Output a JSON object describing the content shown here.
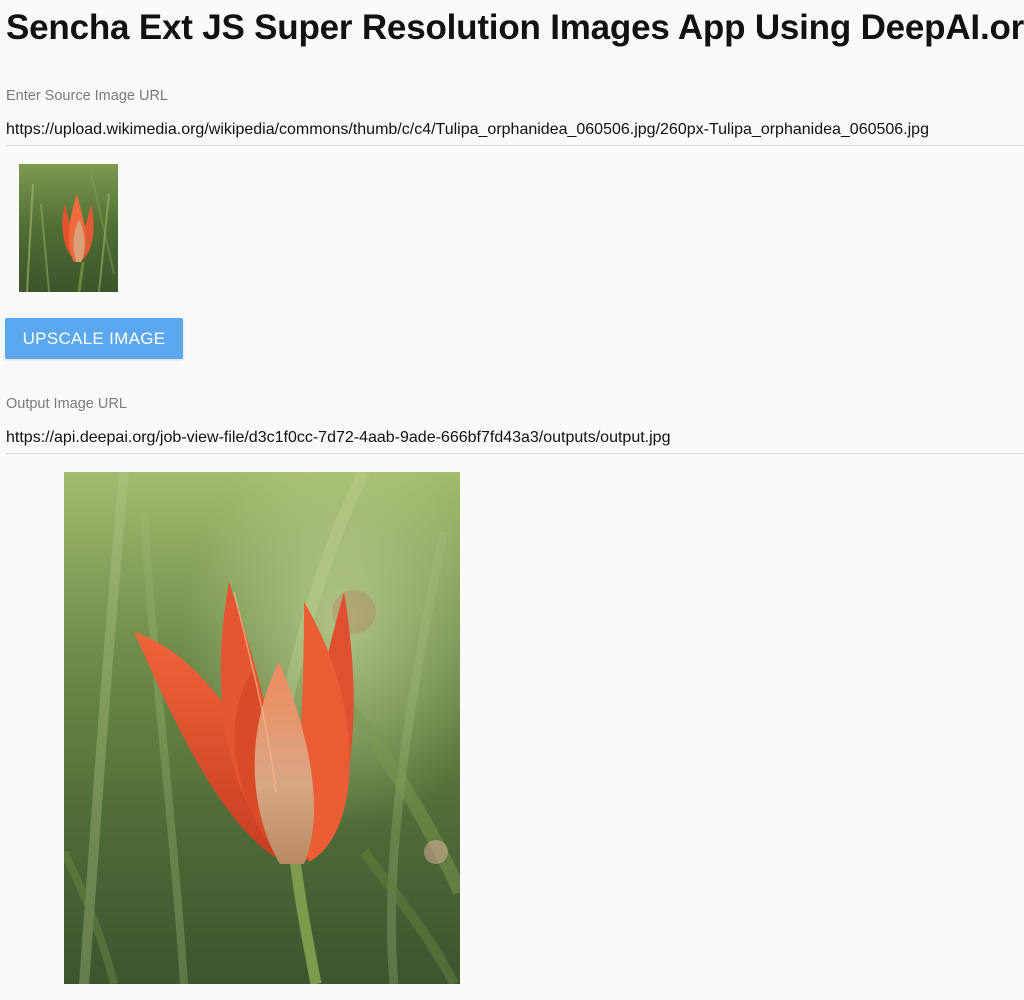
{
  "page": {
    "title": "Sencha Ext JS Super Resolution Images App Using DeepAI.org"
  },
  "source": {
    "label": "Enter Source Image URL",
    "value": "https://upload.wikimedia.org/wikipedia/commons/thumb/c/c4/Tulipa_orphanidea_060506.jpg/260px-Tulipa_orphanidea_060506.jpg"
  },
  "actions": {
    "upscale_label": "UPSCALE IMAGE"
  },
  "output": {
    "label": "Output Image URL",
    "value": "https://api.deepai.org/job-view-file/d3c1f0cc-7d72-4aab-9ade-666bf7fd43a3/outputs/output.jpg"
  },
  "colors": {
    "accent": "#5ba8f0",
    "background": "#fafafa"
  }
}
